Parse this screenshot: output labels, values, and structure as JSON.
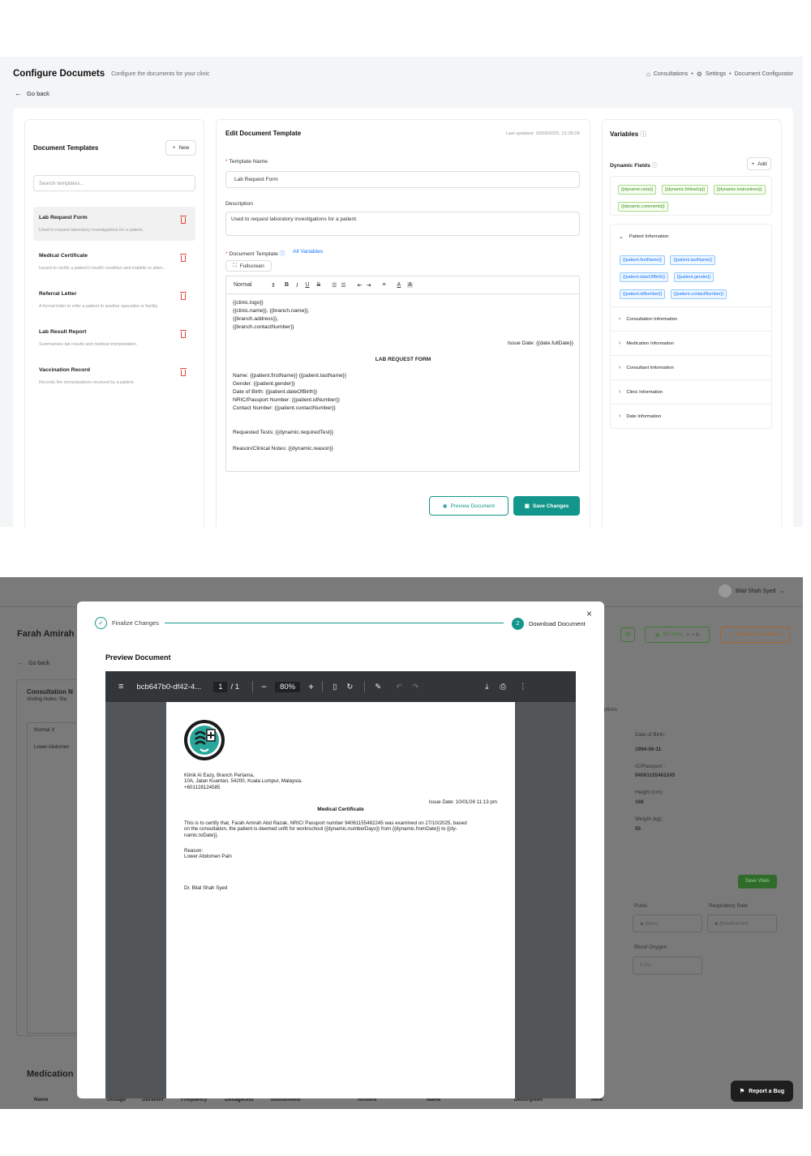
{
  "configurator": {
    "title": "Configure Documets",
    "subtitle": "Configure the documents for your clinic",
    "breadcrumb": [
      "Consultations",
      "Settings",
      "Document Configurator"
    ],
    "go_back": "Go back",
    "templates_panel": {
      "title": "Document Templates",
      "new_button": "New",
      "search_placeholder": "Search templates...",
      "items": [
        {
          "name": "Lab Request Form",
          "desc": "Used to request laboratory investigations for a patient."
        },
        {
          "name": "Medical Certificate",
          "desc": "Issued to certify a patient's health condition and inability to atten..."
        },
        {
          "name": "Referral Letter",
          "desc": "A formal letter to refer a patient to another specialist or facility."
        },
        {
          "name": "Lab Result Report",
          "desc": "Summarises lab results and medical interpretation."
        },
        {
          "name": "Vaccination Record",
          "desc": "Records the immunisations received by a patient."
        }
      ]
    },
    "edit_panel": {
      "title": "Edit Document Template",
      "last_updated": "Last updated: 10/09/2025, 21:35:05",
      "template_name_label": "Template Name",
      "template_name_value": "Lab Request Form",
      "description_label": "Description",
      "description_value": "Used to request laboratory investigations for a patient.",
      "document_template_label": "Document Template",
      "all_variables_link": "All Variables",
      "fullscreen_button": "Fullscreen",
      "toolbar_style": "Normal",
      "editor": {
        "header_lines": [
          "{{clinic.logo}}",
          "{{clinic.name}}, {{branch.name}},",
          "{{branch.address}},",
          "{{branch.contactNumber}}"
        ],
        "issue_date": "Issue Date: {{date.fullDate}}",
        "heading": "LAB REQUEST FORM",
        "patient_lines": [
          "Name: {{patient.firstName}} {{patient.lastName}}",
          "Gender: {{patient.gender}}",
          "Date of Birth: {{patient.dateOfBirth}}",
          "NRIC/Passport Number: {{patient.idNumber}}",
          "Contact Number: {{patient.contactNumber}}"
        ],
        "requested_tests": "Requested Tests: {{dynamic.requiredTest}}",
        "reason": "Reason/Clinical Notes: {{dynamic.reason}}"
      },
      "preview_button": "Preview Document",
      "save_button": "Save Changes"
    },
    "variables_panel": {
      "title": "Variables",
      "dynamic_fields_title": "Dynamic Fields",
      "add_button": "Add",
      "dynamic_tags": [
        "{{dynamic.note}}",
        "{{dynamic.followUp}}",
        "{{dynamic.instructions}}",
        "{{dynamic.comments}}"
      ],
      "patient_section": "Patient Information",
      "patient_tags": [
        "{{patient.firstName}}",
        "{{patient.lastName}}",
        "{{patient.dateOfBirth}}",
        "{{patient.gender}}",
        "{{patient.idNumber}}",
        "{{patient.contactNumber}}"
      ],
      "sections": [
        "Consultation Information",
        "Medication Information",
        "Consultant Information",
        "Clinic Information",
        "Date Information"
      ]
    }
  },
  "consultation": {
    "user_name": "Bilal Shah Syed",
    "patient_name": "Farah Amirah A",
    "bill_items": "Bill Items",
    "shortcut": "⇧ + N",
    "request_consultation": "Request Consultation",
    "go_back": "Go back",
    "consultation_label": "Consultation N",
    "visiting_notes": "Visiting Notes: Sta",
    "editor_style": "Normal",
    "lower_abdomen": "Lower Abdomen",
    "options_label": "ptions",
    "dob_label": "Date of Birth:",
    "dob_value": "1994-06-11",
    "ic_label": "IC/Passport :",
    "ic_value": "94061155462245",
    "height_label": "Height (cm):",
    "height_value": "166",
    "weight_label": "Weight (kg):",
    "weight_value": "55",
    "save_vitals": "Save Vitals",
    "pulse_label": "Pulse",
    "pulse_placeholder": "(bpm)",
    "resp_label": "Respiratory Rate",
    "resp_placeholder": "(breaths/min)",
    "oxygen_label": "Blood Oxygen",
    "oxygen_placeholder": "0 (%)",
    "medication_title": "Medication",
    "med_columns": [
      "Name",
      "Dosage",
      "Duration",
      "Frequency",
      "DosageUnit",
      "Instructions",
      "Actions",
      "Name",
      "Description",
      "Note"
    ],
    "report_bug": "Report a Bug"
  },
  "modal": {
    "step1": "Finalize Changes",
    "step2_number": "2",
    "step2": "Download Document",
    "heading": "Preview Document",
    "pdf": {
      "filename": "bcb647b0-df42-4...",
      "page_current": "1",
      "page_total": "/ 1",
      "zoom": "80%",
      "clinic_lines": [
        "Klinik Al Eazy, Branch Pertama,",
        "10A, Jalan Kuantan, 54200, Kuala Lumpur, Malaysia.",
        "+601128124585"
      ],
      "issue_date": "Issue Date: 10/01/26 11:13 pm",
      "title": "Medical Certificate",
      "body_lines": [
        "This is to certify that, Farah Amirah Abd Razak, NRIC/ Passport number 94061155462245 was examined on 27/10/2025, based",
        "on the consultation, the patient is deemed unfit for work/school {{dynamic.numberDays}} from {{dynamic.fromDate}} to {{dy-",
        "namic.toDate}}."
      ],
      "reason_label": "Reason:",
      "reason_value": "Lower Abdomen Pain",
      "doctor": "Dr. Bilal Shah Syed"
    }
  },
  "colors": {
    "teal": "#13978c",
    "danger": "#e0443c",
    "link": "#1677ff"
  }
}
